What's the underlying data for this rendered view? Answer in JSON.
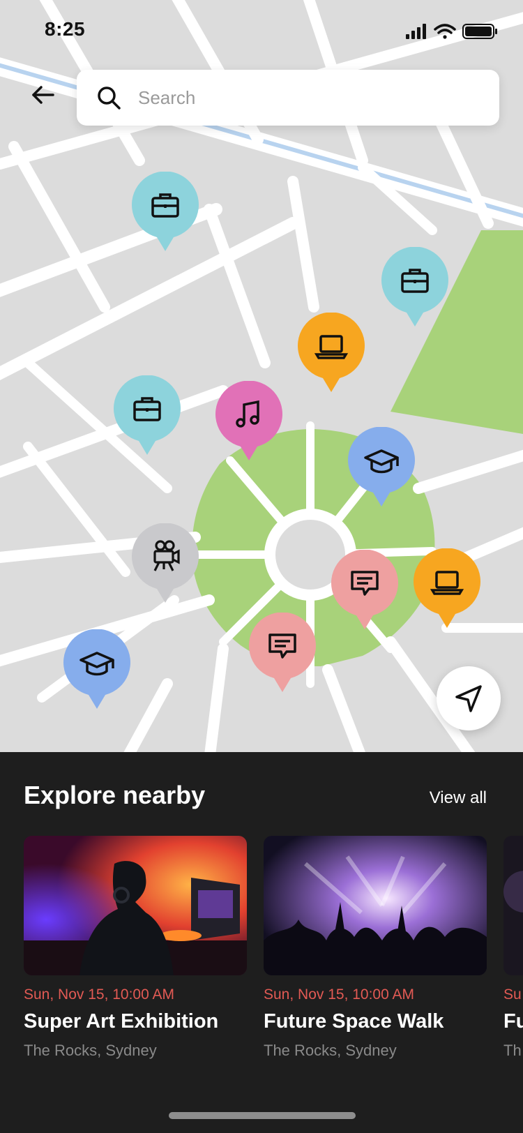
{
  "status_bar": {
    "time": "8:25"
  },
  "search": {
    "placeholder": "Search"
  },
  "colors": {
    "map_bg": "#dcdcdc",
    "road": "#ffffff",
    "park": "#a8d27a",
    "river": "#b8d3ef",
    "pin_business": "#8dd3dc",
    "pin_tech": "#f7a620",
    "pin_music": "#e171b7",
    "pin_education": "#86adec",
    "pin_film": "#c9c9cc",
    "pin_chat": "#eea0a0",
    "date_accent": "#e25a54",
    "panel_bg": "#1e1e1e"
  },
  "map_pins": [
    {
      "category": "business",
      "icon": "briefcase-icon"
    },
    {
      "category": "business",
      "icon": "briefcase-icon"
    },
    {
      "category": "tech",
      "icon": "laptop-icon"
    },
    {
      "category": "business",
      "icon": "briefcase-icon"
    },
    {
      "category": "music",
      "icon": "music-note-icon"
    },
    {
      "category": "education",
      "icon": "graduation-cap-icon"
    },
    {
      "category": "film",
      "icon": "video-camera-icon"
    },
    {
      "category": "chat",
      "icon": "chat-bubble-icon"
    },
    {
      "category": "tech",
      "icon": "laptop-icon"
    },
    {
      "category": "chat",
      "icon": "chat-bubble-icon"
    },
    {
      "category": "education",
      "icon": "graduation-cap-icon"
    }
  ],
  "explore": {
    "title": "Explore nearby",
    "view_all": "View all",
    "cards": [
      {
        "date": "Sun, Nov 15, 10:00 AM",
        "title": "Super Art Exhibition",
        "location": "The Rocks, Sydney"
      },
      {
        "date": "Sun, Nov 15, 10:00 AM",
        "title": "Future Space Walk",
        "location": "The Rocks, Sydney"
      },
      {
        "date": "Su",
        "title": "Fu",
        "location": "Th"
      }
    ]
  }
}
